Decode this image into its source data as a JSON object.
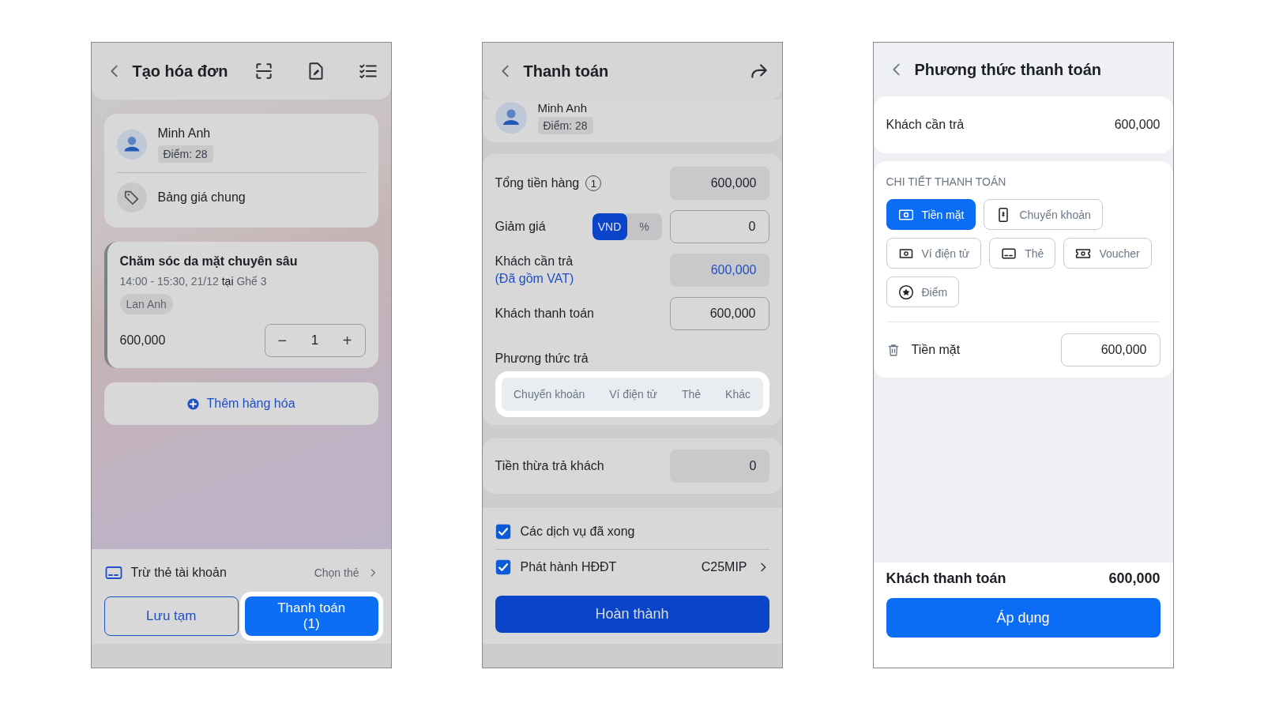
{
  "screens": [
    {
      "kind": "invoice",
      "dimmed": true,
      "title": "Tạo hóa đơn",
      "customer": {
        "name": "Minh Anh",
        "points": "Điểm: 28"
      },
      "price_list": "Bảng giá chung",
      "service": {
        "name": "Chăm sóc da mặt chuyên sâu",
        "schedule": "14:00 - 15:30, 21/12 **tại** Ghế 3",
        "staff": "Lan Anh",
        "price": "600,000",
        "quantity": "1",
        "decrease": "−",
        "increase": "+"
      },
      "add_item": "Thêm hàng hóa",
      "card_deduction": {
        "label": "Trừ thẻ tài khoản",
        "action": "Chọn thẻ"
      },
      "buttons": [
        {
          "label": "Lưu tạm",
          "kind": "outline",
          "highlighted": false
        },
        {
          "label": "Thanh toán\n(1)",
          "kind": "primary",
          "highlighted": true
        }
      ]
    },
    {
      "kind": "payment",
      "dimmed": true,
      "title": "Thanh toán",
      "customer": {
        "name": "Minh Anh",
        "points": "Điểm: 28"
      },
      "total": {
        "label": "Tổng tiền hàng",
        "count": "1",
        "value": "600,000"
      },
      "discount": {
        "label": "Giảm giá",
        "units": [
          {
            "label": "VND",
            "selected": true
          },
          {
            "label": "%",
            "selected": false
          }
        ],
        "value": "0"
      },
      "amount_due": {
        "label": "Khách cần trả",
        "note": "(Đã gồm VAT)",
        "value": "600,000"
      },
      "customer_pays": {
        "label": "Khách thanh toán",
        "value": "600,000"
      },
      "payment_methods": {
        "label": "Phương thức trả",
        "highlighted": true,
        "options": [
          {
            "label": "Chuyển khoản",
            "selected": false
          },
          {
            "label": "Ví điện tử",
            "selected": false
          },
          {
            "label": "Thẻ",
            "selected": false
          },
          {
            "label": "Khác",
            "selected": false
          }
        ]
      },
      "change": {
        "label": "Tiền thừa trả khách",
        "value": "0"
      },
      "checks": [
        {
          "label": "Các dịch vụ đã xong",
          "checked": true
        },
        {
          "label": "Phát hành HĐĐT",
          "checked": true,
          "value": "C25MIP"
        }
      ],
      "button": "Hoàn thành"
    },
    {
      "kind": "method",
      "dimmed": false,
      "title": "Phương thức thanh toán",
      "amount_due": {
        "label": "Khách cần trả",
        "value": "600,000"
      },
      "section": "CHI TIẾT THANH TOÁN",
      "methods": [
        {
          "label": "Tiền mặt",
          "kind": "cash",
          "selected": true
        },
        {
          "label": "Chuyển khoản",
          "kind": "transfer",
          "selected": false
        },
        {
          "label": "Ví điện tử",
          "kind": "wallet",
          "selected": false
        },
        {
          "label": "Thẻ",
          "kind": "card",
          "selected": false
        },
        {
          "label": "Voucher",
          "kind": "voucher",
          "selected": false
        },
        {
          "label": "Điểm",
          "kind": "points",
          "selected": false
        }
      ],
      "lines": [
        {
          "label": "Tiền mặt",
          "value": "600,000"
        }
      ],
      "total": {
        "label": "Khách thanh toán",
        "value": "600,000"
      },
      "button": "Áp dụng"
    }
  ]
}
